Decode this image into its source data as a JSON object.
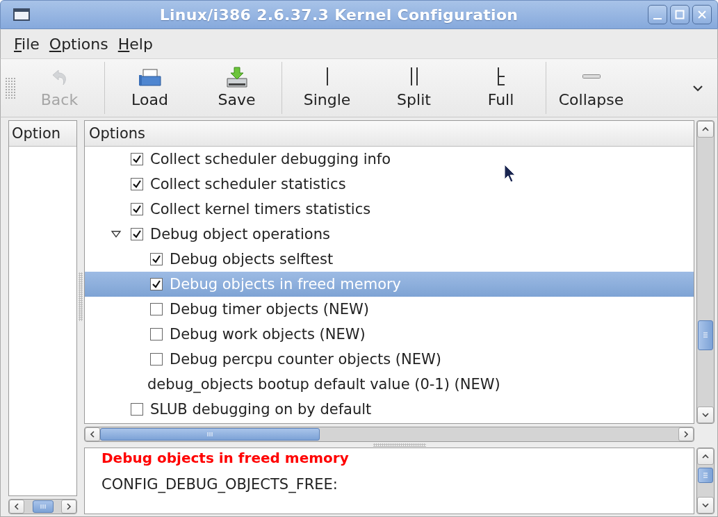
{
  "window": {
    "title": "Linux/i386 2.6.37.3 Kernel Configuration"
  },
  "menu": [
    "File",
    "Options",
    "Help"
  ],
  "toolbar": {
    "groups": [
      [
        {
          "label": "Back",
          "disabled": true
        }
      ],
      [
        {
          "label": "Load",
          "disabled": false
        },
        {
          "label": "Save",
          "disabled": false
        }
      ],
      [
        {
          "label": "Single",
          "disabled": false
        },
        {
          "label": "Split",
          "disabled": false
        },
        {
          "label": "Full",
          "disabled": false
        }
      ],
      [
        {
          "label": "Collapse",
          "disabled": false
        }
      ]
    ]
  },
  "left_pane": {
    "header": "Option"
  },
  "tree": {
    "header": "Options",
    "items": [
      {
        "kind": "check",
        "label": "Collect scheduler debugging info",
        "checked": true,
        "selected": false
      },
      {
        "kind": "check",
        "label": "Collect scheduler statistics",
        "checked": true,
        "selected": false
      },
      {
        "kind": "check",
        "label": "Collect kernel timers statistics",
        "checked": true,
        "selected": false
      },
      {
        "kind": "check",
        "label": "Debug object operations",
        "checked": true,
        "selected": false,
        "expanded": true,
        "children": [
          {
            "kind": "check",
            "label": "Debug objects selftest",
            "checked": true,
            "selected": false
          },
          {
            "kind": "check",
            "label": "Debug objects in freed memory",
            "checked": true,
            "selected": true
          },
          {
            "kind": "check",
            "label": "Debug timer objects (NEW)",
            "checked": false,
            "selected": false
          },
          {
            "kind": "check",
            "label": "Debug work objects (NEW)",
            "checked": false,
            "selected": false
          },
          {
            "kind": "check",
            "label": "Debug percpu counter objects (NEW)",
            "checked": false,
            "selected": false
          },
          {
            "kind": "text",
            "label": "debug_objects bootup default value (0-1) (NEW)",
            "selected": false
          }
        ]
      },
      {
        "kind": "check",
        "label": "SLUB debugging on by default",
        "checked": false,
        "selected": false
      }
    ]
  },
  "help": {
    "title": "Debug objects in freed memory",
    "symbol": "CONFIG_DEBUG_OBJECTS_FREE:"
  }
}
